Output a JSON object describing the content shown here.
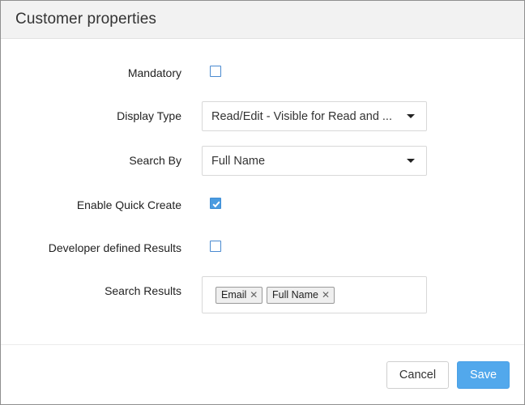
{
  "dialog": {
    "title": "Customer properties"
  },
  "form": {
    "mandatory": {
      "label": "Mandatory",
      "checked": false
    },
    "display_type": {
      "label": "Display Type",
      "value": "Read/Edit - Visible for Read and ..."
    },
    "search_by": {
      "label": "Search By",
      "value": "Full Name"
    },
    "enable_quick_create": {
      "label": "Enable Quick Create",
      "checked": true
    },
    "developer_defined_results": {
      "label": "Developer defined Results",
      "checked": false
    },
    "search_results": {
      "label": "Search Results",
      "tags": [
        {
          "label": "Email",
          "remove_icon": "close-icon"
        },
        {
          "label": "Full Name",
          "remove_icon": "close-icon"
        }
      ]
    }
  },
  "footer": {
    "cancel_label": "Cancel",
    "save_label": "Save"
  },
  "colors": {
    "accent": "#52a8ec",
    "header_bg": "#f2f2f2"
  }
}
